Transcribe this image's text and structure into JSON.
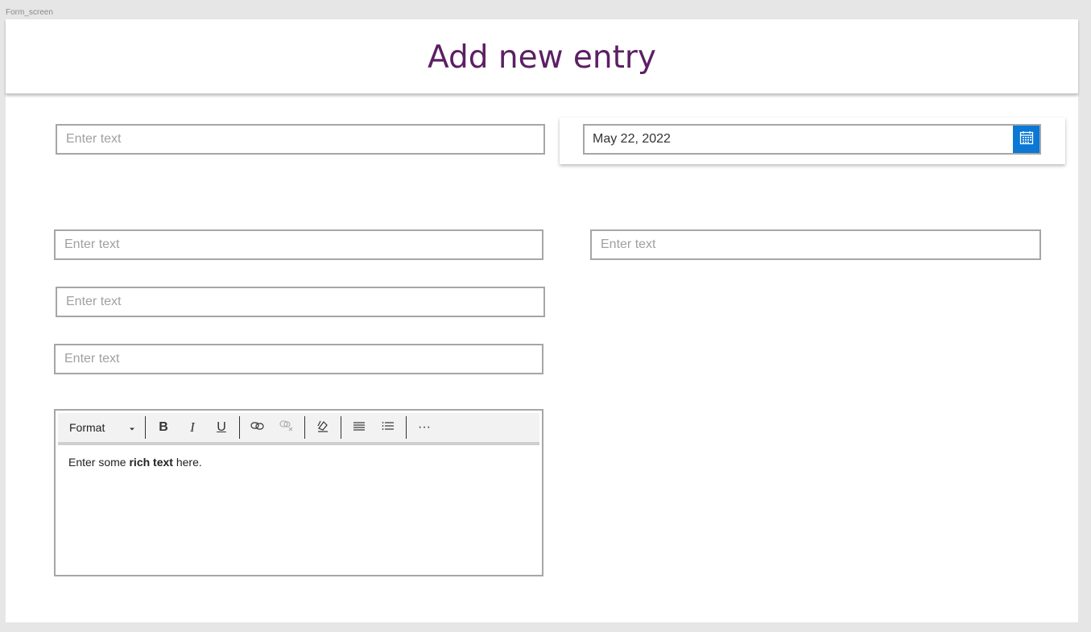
{
  "frame_label": "Form_screen",
  "header": {
    "title": "Add new entry"
  },
  "fields": {
    "text_1": {
      "placeholder": "Enter text"
    },
    "text_2": {
      "placeholder": "Enter text"
    },
    "text_3": {
      "placeholder": "Enter text"
    },
    "text_4": {
      "placeholder": "Enter text"
    },
    "text_5": {
      "placeholder": "Enter text"
    }
  },
  "date_picker": {
    "value": "May 22, 2022",
    "button_icon": "calendar-icon"
  },
  "rich_text": {
    "toolbar": {
      "format_label": "Format",
      "bold_label": "B",
      "italic_label": "I",
      "underline_label": "U",
      "more_label": "···"
    },
    "content": {
      "prefix": "Enter some ",
      "bold": "rich text",
      "suffix": " here."
    }
  },
  "colors": {
    "title": "#5c1f64",
    "accent": "#0a78d4",
    "border": "#a6a6a6"
  }
}
